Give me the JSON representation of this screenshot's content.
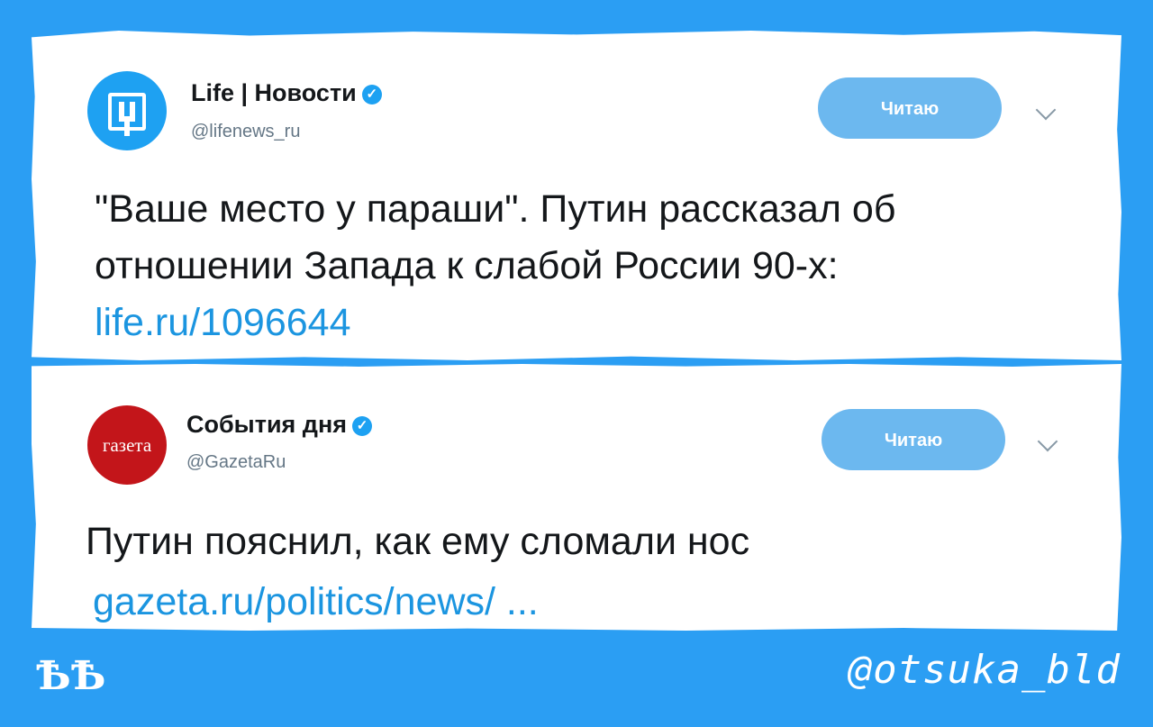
{
  "tweets": [
    {
      "author_name": "Life | Новости",
      "handle": "@lifenews_ru",
      "follow_label": "Читаю",
      "text_lines": [
        "\"Ваше место у параши\". Путин рассказал об",
        "отношении Запада к слабой России 90-х:"
      ],
      "link": "life.ru/1096644",
      "avatar_icon": "life-logo-icon"
    },
    {
      "author_name": "События дня",
      "handle": "@GazetaRu",
      "follow_label": "Читаю",
      "text_lines": [
        "Путин пояснил, как ему сломали нос"
      ],
      "link": "gazeta.ru/politics/news/ ...",
      "avatar_text": "газета"
    }
  ],
  "brand_mark": "ѢѢ",
  "signature": "@otsuka_bld",
  "colors": {
    "background": "#2b9ef3",
    "link": "#1b95e0",
    "follow_button": "#6cb8ef",
    "gazeta_red": "#c3151a"
  }
}
